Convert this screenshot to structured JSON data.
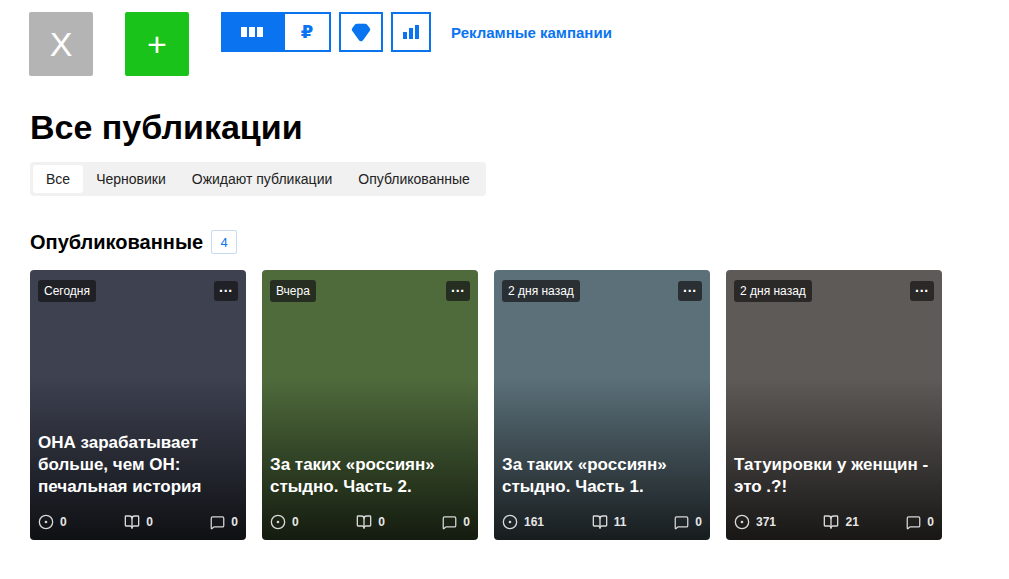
{
  "toolbar": {
    "close_button": "X",
    "add_button": "+",
    "view_switch": [
      {
        "kind": "columns",
        "selected": true
      },
      {
        "kind": "text",
        "label": "₽",
        "selected": false
      }
    ],
    "tool_buttons": [
      {
        "kind": "diamond"
      },
      {
        "kind": "chart"
      }
    ],
    "link": "Рекламные кампании"
  },
  "page_title": "Все публикации",
  "tabs": [
    {
      "label": "Все",
      "selected": true
    },
    {
      "label": "Черновики",
      "selected": false
    },
    {
      "label": "Ожидают публикации",
      "selected": false
    },
    {
      "label": "Опубликованные",
      "selected": false
    }
  ],
  "section": {
    "title": "Опубликованные",
    "count": "4"
  },
  "cards": [
    {
      "time": "Сегодня",
      "menu": "···",
      "title": "ОНА зарабатывает больше, чем ОН: печальная история",
      "views": "0",
      "reads": "0",
      "comments": "0"
    },
    {
      "time": "Вчера",
      "menu": "···",
      "title": "За таких «россиян» стыдно. Часть 2.",
      "views": "0",
      "reads": "0",
      "comments": "0"
    },
    {
      "time": "2 дня назад",
      "menu": "···",
      "title": "За таких «россиян» стыдно. Часть 1.",
      "views": "161",
      "reads": "11",
      "comments": "0"
    },
    {
      "time": "2 дня назад",
      "menu": "···",
      "title": "Татуировки у женщин - это .?!",
      "views": "371",
      "reads": "21",
      "comments": "0"
    }
  ]
}
